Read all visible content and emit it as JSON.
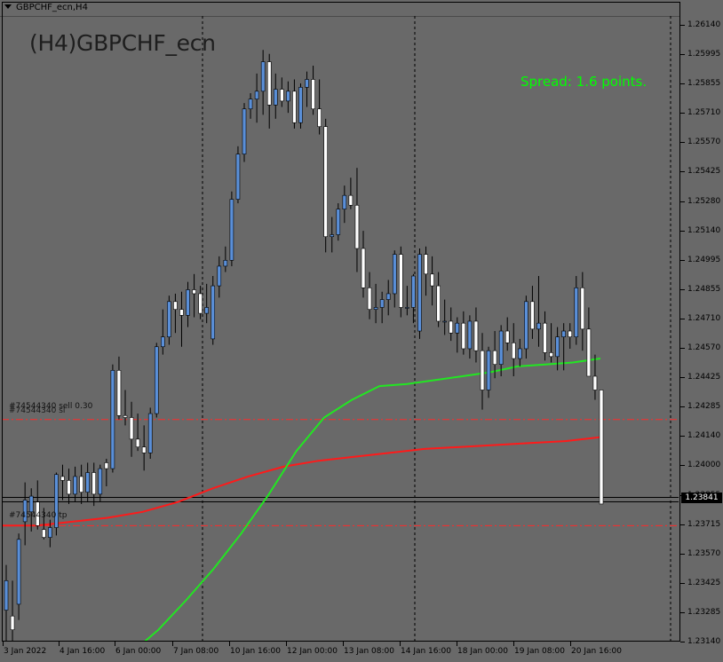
{
  "window": {
    "title": "GBPCHF_ecn,H4"
  },
  "chart": {
    "symbol_label": "(H4)GBPCHF_ecn",
    "spread_label": "Spread: 1.6 points.",
    "colors": {
      "background": "#696969",
      "bull_candle": "#5a8fd8",
      "bear_candle": "#ffffff",
      "ma_fast": "#22e622",
      "ma_slow": "#ff1a1a",
      "order_line": "#ff2a2a",
      "spread_text": "#00ff00"
    },
    "current_price": "1.23841",
    "order_labels": {
      "sell": "#74544340 sell 0.30",
      "sell_sl": "#74544340 sl",
      "tp": "#74544340 tp"
    }
  },
  "price_axis": {
    "labels": [
      "1.26140",
      "1.25995",
      "1.25855",
      "1.25710",
      "1.25570",
      "1.25425",
      "1.25280",
      "1.25140",
      "1.24995",
      "1.24855",
      "1.24710",
      "1.24570",
      "1.24425",
      "1.24285",
      "1.24140",
      "1.24000",
      "1.23855",
      "1.23715",
      "1.23570",
      "1.23425",
      "1.23285",
      "1.23140"
    ]
  },
  "time_axis": {
    "labels": [
      "3 Jan 2022",
      "4 Jan 16:00",
      "6 Jan 00:00",
      "7 Jan 08:00",
      "10 Jan 16:00",
      "12 Jan 00:00",
      "13 Jan 08:00",
      "14 Jan 16:00",
      "18 Jan 00:00",
      "19 Jan 08:00",
      "20 Jan 16:00"
    ]
  },
  "chart_data": {
    "type": "candlestick",
    "symbol": "GBPCHF_ecn",
    "timeframe": "H4",
    "ylim": [
      1.2314,
      1.2628
    ],
    "candles": [
      {
        "o": 1.233,
        "h": 1.2353,
        "l": 1.2314,
        "c": 1.2345
      },
      {
        "o": 1.2327,
        "h": 1.2345,
        "l": 1.2314,
        "c": 1.232
      },
      {
        "o": 1.2333,
        "h": 1.2369,
        "l": 1.2325,
        "c": 1.2366
      },
      {
        "o": 1.2375,
        "h": 1.2395,
        "l": 1.2363,
        "c": 1.2386
      },
      {
        "o": 1.238,
        "h": 1.2392,
        "l": 1.237,
        "c": 1.2388
      },
      {
        "o": 1.2385,
        "h": 1.2396,
        "l": 1.2371,
        "c": 1.2373
      },
      {
        "o": 1.2371,
        "h": 1.2382,
        "l": 1.2366,
        "c": 1.2367
      },
      {
        "o": 1.2367,
        "h": 1.2376,
        "l": 1.2362,
        "c": 1.2372
      },
      {
        "o": 1.2372,
        "h": 1.24,
        "l": 1.2368,
        "c": 1.2399
      },
      {
        "o": 1.2398,
        "h": 1.2404,
        "l": 1.2386,
        "c": 1.2396
      },
      {
        "o": 1.2396,
        "h": 1.2402,
        "l": 1.2384,
        "c": 1.2389
      },
      {
        "o": 1.2389,
        "h": 1.2403,
        "l": 1.2385,
        "c": 1.2398
      },
      {
        "o": 1.2398,
        "h": 1.2404,
        "l": 1.2384,
        "c": 1.239
      },
      {
        "o": 1.239,
        "h": 1.2405,
        "l": 1.2385,
        "c": 1.24
      },
      {
        "o": 1.24,
        "h": 1.2405,
        "l": 1.2383,
        "c": 1.2389
      },
      {
        "o": 1.2389,
        "h": 1.2404,
        "l": 1.2385,
        "c": 1.2402
      },
      {
        "o": 1.2405,
        "h": 1.2407,
        "l": 1.2393,
        "c": 1.2402
      },
      {
        "o": 1.2402,
        "h": 1.2455,
        "l": 1.24,
        "c": 1.2452
      },
      {
        "o": 1.2452,
        "h": 1.2459,
        "l": 1.2427,
        "c": 1.2429
      },
      {
        "o": 1.2429,
        "h": 1.2442,
        "l": 1.2424,
        "c": 1.2428
      },
      {
        "o": 1.2428,
        "h": 1.2436,
        "l": 1.2408,
        "c": 1.2417
      },
      {
        "o": 1.2417,
        "h": 1.243,
        "l": 1.2411,
        "c": 1.2413
      },
      {
        "o": 1.2413,
        "h": 1.2424,
        "l": 1.2401,
        "c": 1.241
      },
      {
        "o": 1.241,
        "h": 1.2433,
        "l": 1.2407,
        "c": 1.243
      },
      {
        "o": 1.243,
        "h": 1.2466,
        "l": 1.2428,
        "c": 1.2464
      },
      {
        "o": 1.2464,
        "h": 1.2483,
        "l": 1.246,
        "c": 1.2469
      },
      {
        "o": 1.2469,
        "h": 1.249,
        "l": 1.2465,
        "c": 1.2487
      },
      {
        "o": 1.2487,
        "h": 1.2491,
        "l": 1.2471,
        "c": 1.2483
      },
      {
        "o": 1.2483,
        "h": 1.2492,
        "l": 1.2464,
        "c": 1.248
      },
      {
        "o": 1.248,
        "h": 1.2497,
        "l": 1.2474,
        "c": 1.2493
      },
      {
        "o": 1.2493,
        "h": 1.2501,
        "l": 1.2479,
        "c": 1.2491
      },
      {
        "o": 1.2491,
        "h": 1.2495,
        "l": 1.2478,
        "c": 1.2481
      },
      {
        "o": 1.2481,
        "h": 1.2496,
        "l": 1.2476,
        "c": 1.2484
      },
      {
        "o": 1.2468,
        "h": 1.25,
        "l": 1.2465,
        "c": 1.2495
      },
      {
        "o": 1.2495,
        "h": 1.251,
        "l": 1.2489,
        "c": 1.2505
      },
      {
        "o": 1.2505,
        "h": 1.2515,
        "l": 1.2502,
        "c": 1.2508
      },
      {
        "o": 1.2508,
        "h": 1.2543,
        "l": 1.2505,
        "c": 1.2539
      },
      {
        "o": 1.2539,
        "h": 1.2566,
        "l": 1.2537,
        "c": 1.2562
      },
      {
        "o": 1.2562,
        "h": 1.2588,
        "l": 1.2558,
        "c": 1.2585
      },
      {
        "o": 1.2585,
        "h": 1.2593,
        "l": 1.258,
        "c": 1.259
      },
      {
        "o": 1.259,
        "h": 1.2603,
        "l": 1.2578,
        "c": 1.2594
      },
      {
        "o": 1.2594,
        "h": 1.2615,
        "l": 1.2582,
        "c": 1.2609
      },
      {
        "o": 1.2609,
        "h": 1.2613,
        "l": 1.2575,
        "c": 1.2587
      },
      {
        "o": 1.2587,
        "h": 1.2603,
        "l": 1.258,
        "c": 1.2595
      },
      {
        "o": 1.2595,
        "h": 1.2601,
        "l": 1.2586,
        "c": 1.2589
      },
      {
        "o": 1.2589,
        "h": 1.2599,
        "l": 1.2583,
        "c": 1.2594
      },
      {
        "o": 1.2594,
        "h": 1.26,
        "l": 1.2575,
        "c": 1.2578
      },
      {
        "o": 1.2578,
        "h": 1.2598,
        "l": 1.2575,
        "c": 1.2596
      },
      {
        "o": 1.2596,
        "h": 1.2604,
        "l": 1.2586,
        "c": 1.26
      },
      {
        "o": 1.26,
        "h": 1.2607,
        "l": 1.2582,
        "c": 1.2585
      },
      {
        "o": 1.2585,
        "h": 1.26,
        "l": 1.2572,
        "c": 1.2576
      },
      {
        "o": 1.2576,
        "h": 1.258,
        "l": 1.2512,
        "c": 1.252
      },
      {
        "o": 1.252,
        "h": 1.253,
        "l": 1.2512,
        "c": 1.2521
      },
      {
        "o": 1.2521,
        "h": 1.2537,
        "l": 1.2518,
        "c": 1.2534
      },
      {
        "o": 1.2534,
        "h": 1.2546,
        "l": 1.2527,
        "c": 1.2541
      },
      {
        "o": 1.2541,
        "h": 1.255,
        "l": 1.2534,
        "c": 1.2536
      },
      {
        "o": 1.2536,
        "h": 1.2555,
        "l": 1.2502,
        "c": 1.2514
      },
      {
        "o": 1.2514,
        "h": 1.2523,
        "l": 1.2489,
        "c": 1.2494
      },
      {
        "o": 1.2494,
        "h": 1.2502,
        "l": 1.2478,
        "c": 1.2483
      },
      {
        "o": 1.2483,
        "h": 1.2496,
        "l": 1.2476,
        "c": 1.2484
      },
      {
        "o": 1.2484,
        "h": 1.2492,
        "l": 1.2476,
        "c": 1.2488
      },
      {
        "o": 1.2488,
        "h": 1.2498,
        "l": 1.248,
        "c": 1.2491
      },
      {
        "o": 1.2491,
        "h": 1.2513,
        "l": 1.2484,
        "c": 1.2511
      },
      {
        "o": 1.2511,
        "h": 1.2515,
        "l": 1.2479,
        "c": 1.2484
      },
      {
        "o": 1.2484,
        "h": 1.2495,
        "l": 1.248,
        "c": 1.2484
      },
      {
        "o": 1.2484,
        "h": 1.2501,
        "l": 1.2476,
        "c": 1.25
      },
      {
        "o": 1.2472,
        "h": 1.2514,
        "l": 1.2468,
        "c": 1.2511
      },
      {
        "o": 1.2511,
        "h": 1.2515,
        "l": 1.249,
        "c": 1.2501
      },
      {
        "o": 1.2501,
        "h": 1.251,
        "l": 1.2485,
        "c": 1.2495
      },
      {
        "o": 1.2495,
        "h": 1.2502,
        "l": 1.2474,
        "c": 1.2477
      },
      {
        "o": 1.2477,
        "h": 1.2488,
        "l": 1.247,
        "c": 1.2477
      },
      {
        "o": 1.2477,
        "h": 1.2484,
        "l": 1.2467,
        "c": 1.2471
      },
      {
        "o": 1.2471,
        "h": 1.2479,
        "l": 1.2461,
        "c": 1.2476
      },
      {
        "o": 1.2476,
        "h": 1.2482,
        "l": 1.246,
        "c": 1.2463
      },
      {
        "o": 1.2463,
        "h": 1.248,
        "l": 1.2458,
        "c": 1.2477
      },
      {
        "o": 1.2477,
        "h": 1.2484,
        "l": 1.2456,
        "c": 1.2462
      },
      {
        "o": 1.2462,
        "h": 1.2471,
        "l": 1.2432,
        "c": 1.2442
      },
      {
        "o": 1.2442,
        "h": 1.2464,
        "l": 1.2438,
        "c": 1.2462
      },
      {
        "o": 1.2462,
        "h": 1.2472,
        "l": 1.2448,
        "c": 1.2455
      },
      {
        "o": 1.2455,
        "h": 1.2475,
        "l": 1.2449,
        "c": 1.2472
      },
      {
        "o": 1.2472,
        "h": 1.2479,
        "l": 1.2462,
        "c": 1.2466
      },
      {
        "o": 1.2466,
        "h": 1.2476,
        "l": 1.2449,
        "c": 1.2458
      },
      {
        "o": 1.2458,
        "h": 1.2468,
        "l": 1.2454,
        "c": 1.2463
      },
      {
        "o": 1.2463,
        "h": 1.249,
        "l": 1.2458,
        "c": 1.2487
      },
      {
        "o": 1.2487,
        "h": 1.2495,
        "l": 1.2468,
        "c": 1.2473
      },
      {
        "o": 1.2473,
        "h": 1.25,
        "l": 1.2464,
        "c": 1.2476
      },
      {
        "o": 1.2476,
        "h": 1.2482,
        "l": 1.2457,
        "c": 1.2461
      },
      {
        "o": 1.2461,
        "h": 1.2476,
        "l": 1.2456,
        "c": 1.2459
      },
      {
        "o": 1.2459,
        "h": 1.2474,
        "l": 1.2452,
        "c": 1.2469
      },
      {
        "o": 1.2469,
        "h": 1.2476,
        "l": 1.2452,
        "c": 1.2472
      },
      {
        "o": 1.2472,
        "h": 1.2476,
        "l": 1.2463,
        "c": 1.2469
      },
      {
        "o": 1.2469,
        "h": 1.25,
        "l": 1.2465,
        "c": 1.2494
      },
      {
        "o": 1.2494,
        "h": 1.2502,
        "l": 1.2462,
        "c": 1.2473
      },
      {
        "o": 1.2473,
        "h": 1.2484,
        "l": 1.2458,
        "c": 1.2449
      },
      {
        "o": 1.2449,
        "h": 1.246,
        "l": 1.2437,
        "c": 1.2442
      },
      {
        "o": 1.2442,
        "h": 1.2442,
        "l": 1.2384,
        "c": 1.2384
      }
    ],
    "moving_averages": [
      {
        "color": "#22e622",
        "values": [
          1.229,
          1.2298,
          1.2308,
          1.232,
          1.2335,
          1.2351,
          1.2369,
          1.2389,
          1.2411,
          1.2428,
          1.2437,
          1.2444,
          1.2445,
          1.2447,
          1.2449,
          1.2451,
          1.2454,
          1.2455,
          1.2456,
          1.2458
        ]
      },
      {
        "color": "#ff1a1a",
        "values": [
          1.2373,
          1.2373,
          1.2375,
          1.2377,
          1.238,
          1.2385,
          1.2392,
          1.2398,
          1.2403,
          1.2406,
          1.2408,
          1.241,
          1.2412,
          1.2413,
          1.2414,
          1.2415,
          1.2416,
          1.2418
        ]
      }
    ],
    "horizontal_lines": [
      {
        "price": 1.2427,
        "style": "dash-dot"
      },
      {
        "price": 1.2373,
        "style": "dash-dot"
      },
      {
        "price": 1.2386,
        "style": "solid"
      }
    ]
  }
}
